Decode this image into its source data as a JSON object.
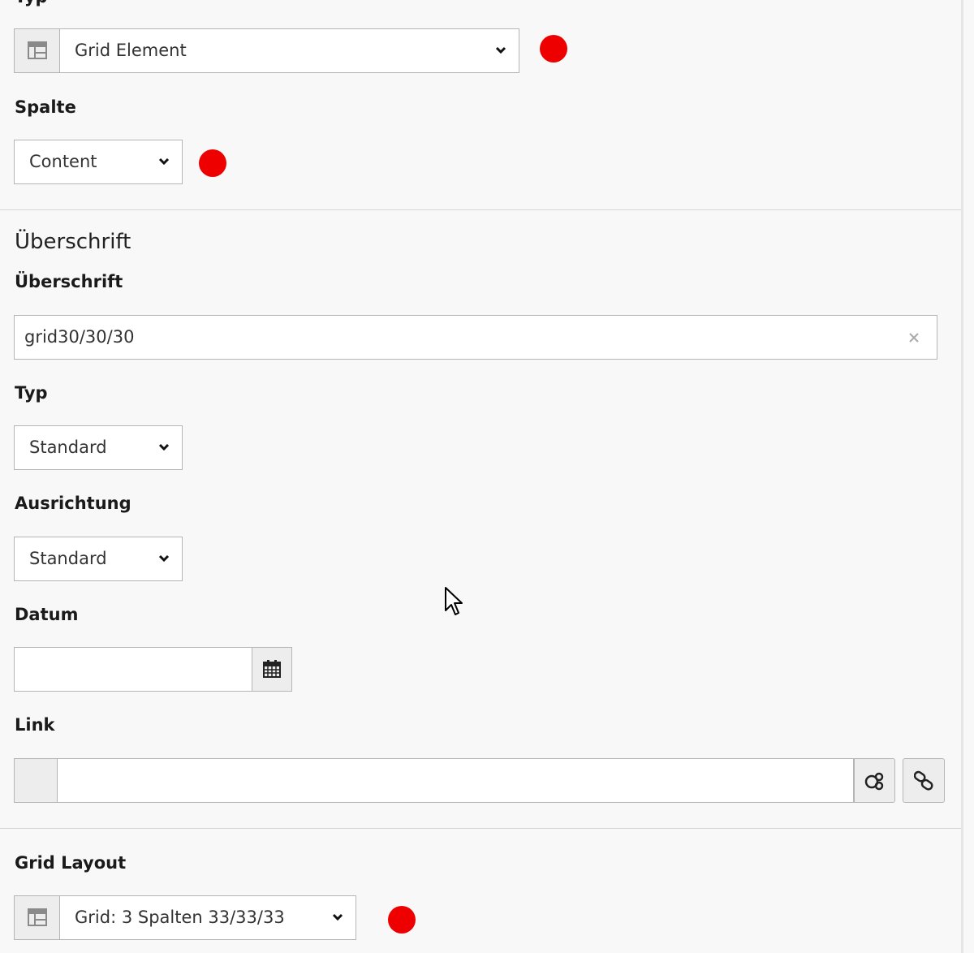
{
  "general": {
    "type_label": "Typ",
    "type_value": "Grid Element",
    "column_label": "Spalte",
    "column_value": "Content"
  },
  "header_section": {
    "title": "Überschrift",
    "header_label": "Überschrift",
    "header_value": "grid30/30/30",
    "header_type_label": "Typ",
    "header_type_value": "Standard",
    "alignment_label": "Ausrichtung",
    "alignment_value": "Standard",
    "date_label": "Datum",
    "date_value": "",
    "link_label": "Link",
    "link_value": ""
  },
  "grid_section": {
    "layout_label": "Grid Layout",
    "layout_value": "Grid: 3 Spalten 33/33/33"
  },
  "icons": {
    "type_icon": "grid-layout-icon",
    "clear": "close-icon",
    "calendar": "calendar-icon",
    "link_browse": "link-browser-icon",
    "link": "chain-link-icon",
    "cursor": "mouse-pointer-icon"
  },
  "colors": {
    "marker": "#ee0000",
    "background": "#f8f8f8",
    "border": "#b5b5b5"
  }
}
